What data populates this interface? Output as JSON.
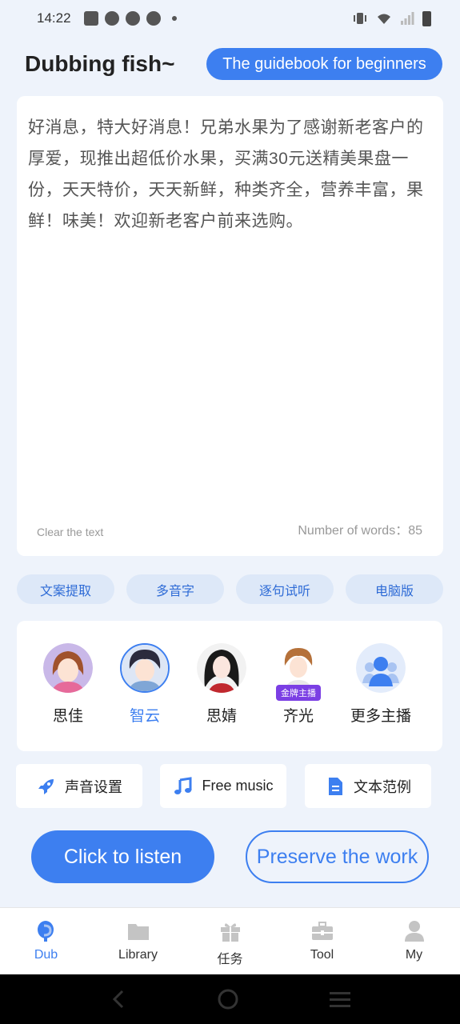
{
  "status_bar": {
    "time": "14:22"
  },
  "header": {
    "title": "Dubbing fish~",
    "guide_label": "The guidebook for beginners"
  },
  "editor": {
    "text": "好消息，特大好消息！兄弟水果为了感谢新老客户的厚爱，现推出超低价水果，买满30元送精美果盘一份，天天特价，天天新鲜，种类齐全，营养丰富，果鲜！味美！欢迎新老客户前来选购。",
    "clear_label": "Clear the text",
    "word_count_label": "Number of words：85"
  },
  "feature_pills": [
    {
      "label": "文案提取"
    },
    {
      "label": "多音字"
    },
    {
      "label": "逐句试听"
    },
    {
      "label": "电脑版"
    }
  ],
  "anchors": [
    {
      "name": "思佳"
    },
    {
      "name": "智云",
      "selected": true
    },
    {
      "name": "思婧"
    },
    {
      "name": "齐光",
      "badge": "金牌主播"
    },
    {
      "name": "更多主播"
    }
  ],
  "tools": [
    {
      "label": "声音设置",
      "icon": "rocket-icon"
    },
    {
      "label": "Free music",
      "icon": "music-note-icon"
    },
    {
      "label": "文本范例",
      "icon": "document-icon"
    }
  ],
  "actions": {
    "listen_label": "Click to listen",
    "preserve_label": "Preserve the work"
  },
  "bottom_nav": [
    {
      "label": "Dub",
      "icon": "microphone-icon",
      "active": true
    },
    {
      "label": "Library",
      "icon": "folder-icon"
    },
    {
      "label": "任务",
      "icon": "gift-icon"
    },
    {
      "label": "Tool",
      "icon": "toolbox-icon"
    },
    {
      "label": "My",
      "icon": "person-icon"
    }
  ],
  "colors": {
    "accent": "#3D7FF0",
    "background": "#EEF3FB",
    "pill_bg": "#DDE8F8"
  }
}
